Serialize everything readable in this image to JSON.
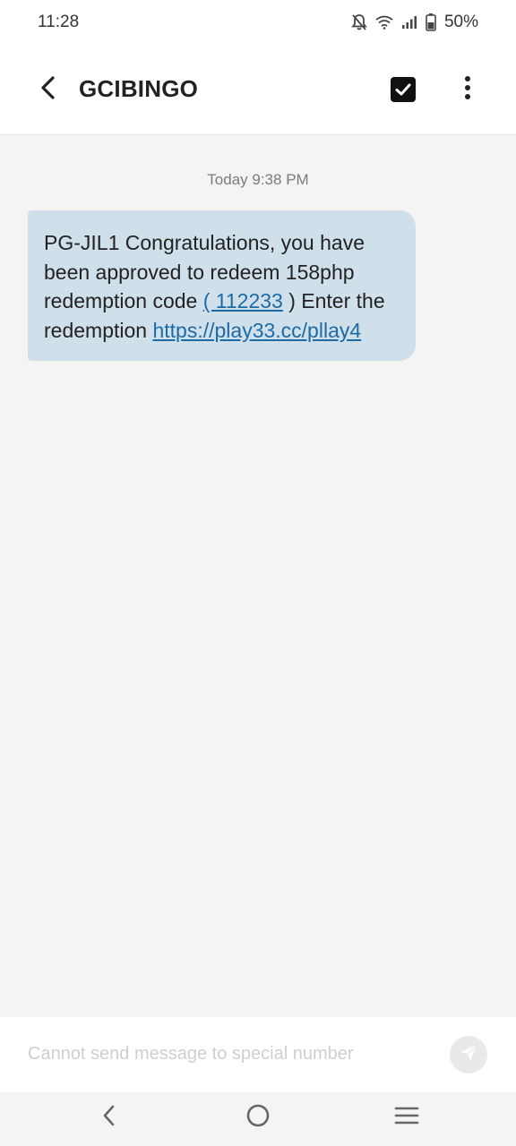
{
  "status_bar": {
    "time": "11:28",
    "battery": "50%",
    "icons": [
      "mute-bell-icon",
      "wifi-icon",
      "signal-icon",
      "battery-icon"
    ]
  },
  "header": {
    "title": "GCIBINGO",
    "back_icon": "back-arrow-icon",
    "select_icon": "checkbox-icon",
    "more_icon": "more-vertical-icon"
  },
  "conversation": {
    "timestamp": "Today 9:38 PM",
    "message": {
      "part1": "PG-JIL1 Congratulations, you have been approved to redeem 158php redemption code ",
      "code_link": "( 112233",
      "part2": " ) Enter the redemption ",
      "url_link": "https://play33.cc/pllay4"
    }
  },
  "composer": {
    "placeholder": "Cannot send message to special number",
    "send_icon": "send-icon"
  },
  "nav_bar": {
    "icons": [
      "nav-back-icon",
      "nav-home-icon",
      "nav-recents-icon"
    ]
  },
  "colors": {
    "bubble": "#d0e0ea",
    "link": "#1d6aa5",
    "background": "#f4f4f5"
  }
}
